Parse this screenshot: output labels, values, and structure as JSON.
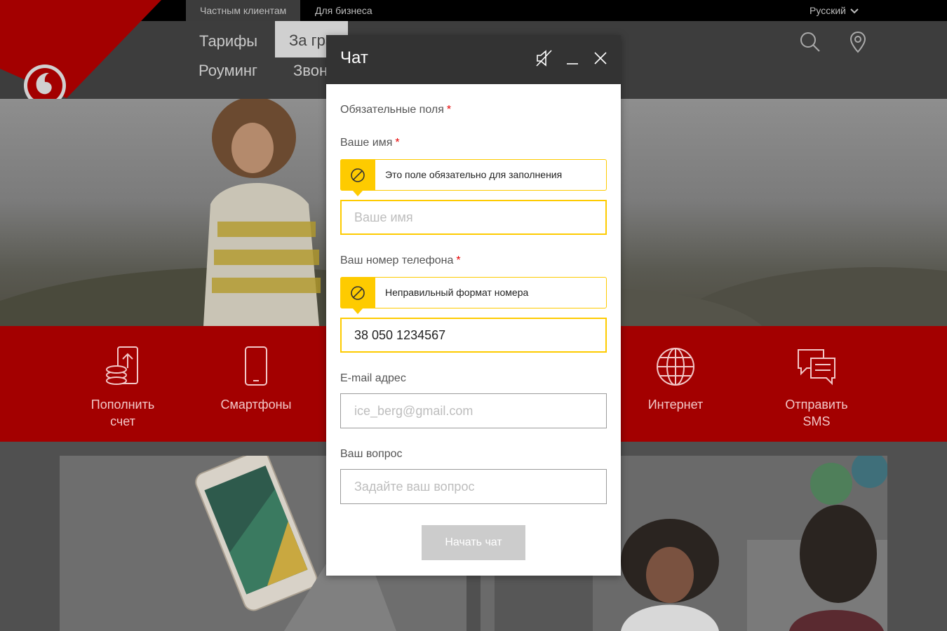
{
  "topbar": {
    "tabs": [
      {
        "label": "Частным клиентам"
      },
      {
        "label": "Для бизнеса"
      }
    ],
    "language": "Русский"
  },
  "nav": {
    "row1": [
      "Тарифы",
      "За гра"
    ],
    "row2": [
      "Роуминг",
      "Звон"
    ]
  },
  "quicklinks": [
    {
      "label": "Пополнить\nсчет",
      "icon": "phone-topup-icon"
    },
    {
      "label": "Смартфоны",
      "icon": "smartphone-icon"
    },
    {
      "label": "Интернет",
      "icon": "globe-icon"
    },
    {
      "label": "Отправить\nSMS",
      "icon": "sms-icon"
    }
  ],
  "chat": {
    "title": "Чат",
    "required_note": "Обязательные поля",
    "asterisk": "*",
    "name": {
      "label": "Ваше имя",
      "error": "Это поле обязательно для заполнения",
      "value": "",
      "placeholder": "Ваше имя"
    },
    "phone": {
      "label": "Ваш номер телефона",
      "error": "Неправильный формат номера",
      "value": "38 050 1234567",
      "placeholder": ""
    },
    "email": {
      "label": "E-mail адрес",
      "value": "",
      "placeholder": "ice_berg@gmail.com"
    },
    "question": {
      "label": "Ваш вопрос",
      "value": "",
      "placeholder": "Задайте ваш вопрос"
    },
    "submit_label": "Начать чат"
  },
  "colors": {
    "brand_red": "#e60000",
    "warning_yellow": "#fecb00",
    "header_dark": "#333333"
  }
}
